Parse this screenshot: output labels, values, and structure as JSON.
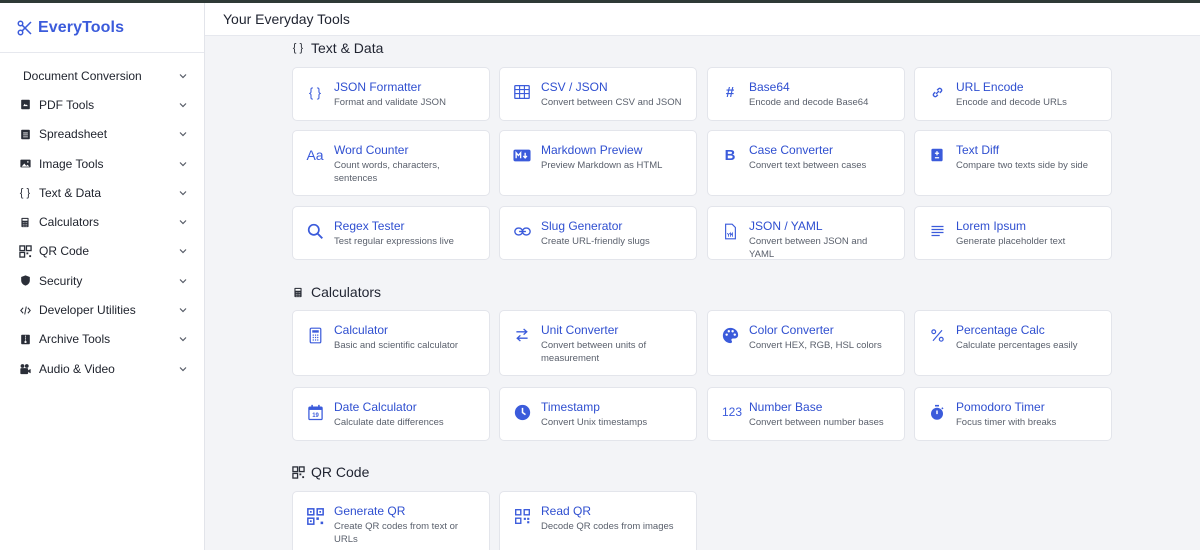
{
  "app": {
    "name": "EveryTools"
  },
  "header": {
    "title": "Your Everyday Tools"
  },
  "sidebar": {
    "items": [
      {
        "label": "Document Conversion",
        "icon": "none"
      },
      {
        "label": "PDF Tools",
        "icon": "pdf-icon"
      },
      {
        "label": "Spreadsheet",
        "icon": "spreadsheet-icon"
      },
      {
        "label": "Image Tools",
        "icon": "image-icon"
      },
      {
        "label": "Text & Data",
        "icon": "braces-icon"
      },
      {
        "label": "Calculators",
        "icon": "calculator-icon"
      },
      {
        "label": "QR Code",
        "icon": "qr-icon"
      },
      {
        "label": "Security",
        "icon": "shield-icon"
      },
      {
        "label": "Developer Utilities",
        "icon": "code-icon"
      },
      {
        "label": "Archive Tools",
        "icon": "archive-icon"
      },
      {
        "label": "Audio & Video",
        "icon": "media-icon"
      }
    ]
  },
  "sections": {
    "text": {
      "title": "Text & Data",
      "cards": [
        {
          "title": "JSON Formatter",
          "desc": "Format and validate JSON",
          "icon": "braces-icon"
        },
        {
          "title": "CSV / JSON",
          "desc": "Convert between CSV and JSON",
          "icon": "table-icon"
        },
        {
          "title": "Base64",
          "desc": "Encode and decode Base64",
          "icon": "hash-icon"
        },
        {
          "title": "URL Encode",
          "desc": "Encode and decode URLs",
          "icon": "link-icon"
        },
        {
          "title": "Word Counter",
          "desc": "Count words, characters, sentences",
          "icon": "text-size-icon"
        },
        {
          "title": "Markdown Preview",
          "desc": "Preview Markdown as HTML",
          "icon": "markdown-icon"
        },
        {
          "title": "Case Converter",
          "desc": "Convert text between cases",
          "icon": "bold-icon"
        },
        {
          "title": "Text Diff",
          "desc": "Compare two texts side by side",
          "icon": "diff-icon"
        },
        {
          "title": "Regex Tester",
          "desc": "Test regular expressions live",
          "icon": "magnifier-icon"
        },
        {
          "title": "Slug Generator",
          "desc": "Create URL-friendly slugs",
          "icon": "chain-icon"
        },
        {
          "title": "JSON / YAML",
          "desc": "Convert between JSON and YAML",
          "icon": "yaml-file-icon"
        },
        {
          "title": "Lorem Ipsum",
          "desc": "Generate placeholder text",
          "icon": "lines-icon"
        }
      ]
    },
    "calc": {
      "title": "Calculators",
      "cards": [
        {
          "title": "Calculator",
          "desc": "Basic and scientific calculator",
          "icon": "calculator-icon"
        },
        {
          "title": "Unit Converter",
          "desc": "Convert between units of measurement",
          "icon": "swap-icon"
        },
        {
          "title": "Color Converter",
          "desc": "Convert HEX, RGB, HSL colors",
          "icon": "palette-icon"
        },
        {
          "title": "Percentage Calc",
          "desc": "Calculate percentages easily",
          "icon": "percent-icon"
        },
        {
          "title": "Date Calculator",
          "desc": "Calculate date differences",
          "icon": "calendar-icon",
          "badge": "19"
        },
        {
          "title": "Timestamp",
          "desc": "Convert Unix timestamps",
          "icon": "clock-icon"
        },
        {
          "title": "Number Base",
          "desc": "Convert between number bases",
          "icon": "numbers-icon",
          "glyph": "123"
        },
        {
          "title": "Pomodoro Timer",
          "desc": "Focus timer with breaks",
          "icon": "stopwatch-icon"
        }
      ]
    },
    "qr": {
      "title": "QR Code",
      "cards": [
        {
          "title": "Generate QR",
          "desc": "Create QR codes from text or URLs",
          "icon": "qr-icon"
        },
        {
          "title": "Read QR",
          "desc": "Decode QR codes from images",
          "icon": "qr-scan-icon"
        }
      ]
    }
  }
}
